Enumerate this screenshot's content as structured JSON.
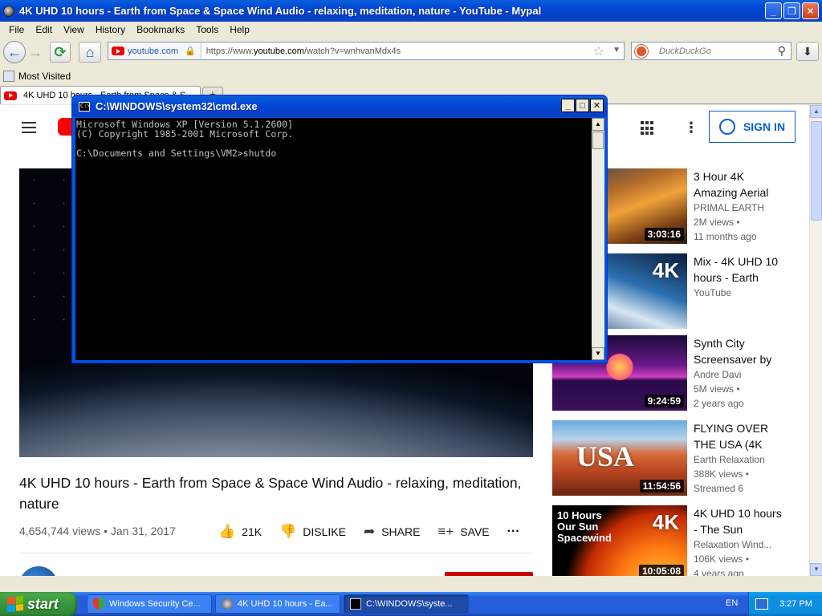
{
  "browser": {
    "title": "4K UHD 10 hours - Earth from Space & Space Wind Audio - relaxing, meditation, nature - YouTube - Mypal",
    "menu": [
      "File",
      "Edit",
      "View",
      "History",
      "Bookmarks",
      "Tools",
      "Help"
    ],
    "site_domain": "youtube.com",
    "url_prefix": "https://www.",
    "url_host": "youtube.com",
    "url_path": "/watch?v=wnhvanMdx4s",
    "search_placeholder": "DuckDuckGo",
    "bookmark": "Most Visited",
    "tab_label": "4K UHD 10 hours - Earth from Space & S..."
  },
  "youtube": {
    "signin": "SIGN IN",
    "video_title": "4K UHD 10 hours - Earth from Space & Space Wind Audio - relaxing, meditation, nature",
    "views_date": "4,654,744 views • Jan 31, 2017",
    "likes": "21K",
    "dislike": "DISLIKE",
    "share": "SHARE",
    "save": "SAVE",
    "recommendations": [
      {
        "title": "3 Hour 4K Amazing Aerial",
        "channel": "PRIMAL EARTH",
        "views": "2M views •",
        "age": "11 months ago",
        "duration": "3:03:16"
      },
      {
        "title": "Mix - 4K UHD 10 hours - Earth",
        "channel": "YouTube",
        "views": "",
        "age": "",
        "duration": "",
        "badge": "4K"
      },
      {
        "title": "Synth City Screensaver by",
        "channel": "Andre Davi",
        "views": "5M views •",
        "age": "2 years ago",
        "duration": "9:24:59"
      },
      {
        "title": "FLYING OVER THE USA (4K",
        "channel": "Earth Relaxation",
        "views": "388K views •",
        "age": "Streamed 6",
        "duration": "11:54:56",
        "badge": "USA"
      },
      {
        "title": "4K UHD 10 hours - The Sun",
        "channel": "Relaxation Wind...",
        "views": "106K views •",
        "age": "4 years ago",
        "duration": "10:05:08",
        "badge": "4K",
        "overlay": "10 Hours\nOur Sun\nSpacewind"
      }
    ]
  },
  "cmd": {
    "title": "C:\\WINDOWS\\system32\\cmd.exe",
    "console_text": "Microsoft Windows XP [Version 5.1.2600]\n(C) Copyright 1985-2001 Microsoft Corp.\n\nC:\\Documents and Settings\\VM2>shutdo"
  },
  "taskbar": {
    "start": "start",
    "items": [
      {
        "label": "Windows Security Ce...",
        "active": false
      },
      {
        "label": "4K UHD 10 hours - Ea...",
        "active": false
      },
      {
        "label": "C:\\WINDOWS\\syste...",
        "active": true
      }
    ],
    "lang": "EN",
    "clock": "3:27 PM"
  }
}
